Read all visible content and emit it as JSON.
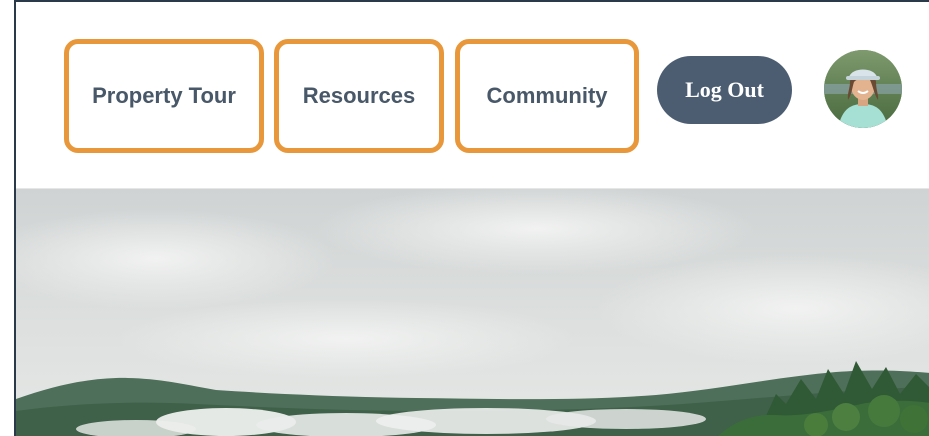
{
  "nav": {
    "items": [
      {
        "label": "Property Tour"
      },
      {
        "label": "Resources"
      },
      {
        "label": "Community"
      }
    ],
    "logout_label": "Log Out"
  },
  "colors": {
    "highlight": "#e8973a",
    "nav_text": "#485868",
    "logout_bg": "#4c5d72"
  }
}
